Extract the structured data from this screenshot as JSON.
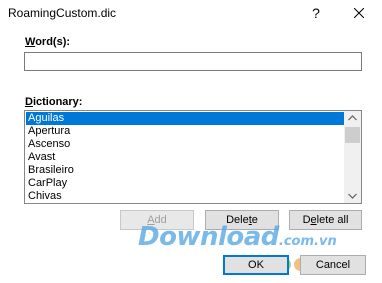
{
  "window": {
    "title": "RoamingCustom.dic",
    "help_label": "?"
  },
  "words": {
    "label_accel": "W",
    "label_rest": "ord(s):",
    "value": ""
  },
  "dictionary": {
    "label_accel": "D",
    "label_rest": "ictionary:",
    "items": [
      "Aguilas",
      "Apertura",
      "Ascenso",
      "Avast",
      "Brasileiro",
      "CarPlay",
      "Chivas"
    ],
    "selected_index": 0,
    "scroll_position": 0.05
  },
  "buttons": {
    "add": {
      "accel": "A",
      "rest": "dd",
      "enabled": false
    },
    "delete": {
      "pre": "Dele",
      "accel": "t",
      "post": "e"
    },
    "delete_all": {
      "pre": "D",
      "accel": "e",
      "post": "lete all"
    },
    "ok": "OK",
    "cancel": "Cancel"
  },
  "watermark": {
    "brand": "Download",
    "domain": ".com.vn",
    "dot_colors": [
      "#4fa3e0",
      "#c9c9c9",
      "#8fd36b",
      "#f2b56b",
      "#f08a8a",
      "#4fa3e0"
    ]
  },
  "colors": {
    "selection": "#0078d7",
    "focus_border": "#0078d7"
  }
}
